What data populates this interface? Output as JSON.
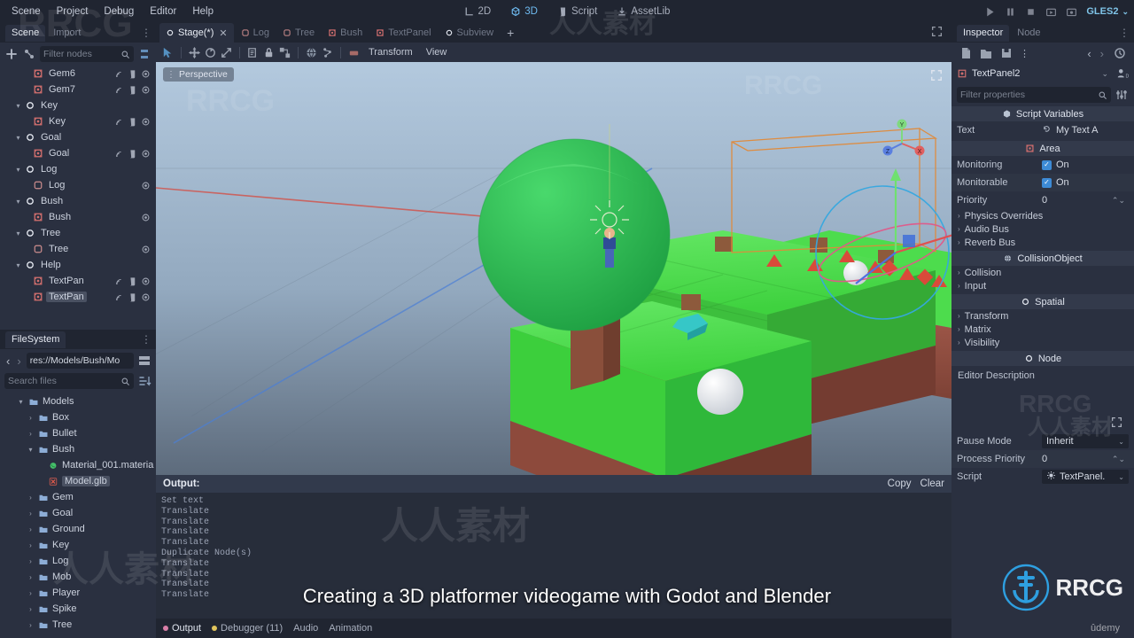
{
  "menubar": {
    "items": [
      "Scene",
      "Project",
      "Debug",
      "Editor",
      "Help"
    ]
  },
  "main_tabs": [
    {
      "label": "2D",
      "icon": "2d-icon",
      "active": false
    },
    {
      "label": "3D",
      "icon": "3d-icon",
      "active": true
    },
    {
      "label": "Script",
      "icon": "script-icon",
      "active": false
    },
    {
      "label": "AssetLib",
      "icon": "assetlib-icon",
      "active": false
    }
  ],
  "runbar": {
    "icons": [
      "play-icon",
      "pause-icon",
      "stop-icon",
      "play-scene-icon",
      "play-custom-scene-icon"
    ],
    "renderer": "GLES2"
  },
  "scene_panel": {
    "tabs": [
      {
        "label": "Scene",
        "active": true
      },
      {
        "label": "Import",
        "active": false
      }
    ],
    "toolbar_icons": [
      "add-node-icon",
      "instance-child-scene-icon"
    ],
    "filter_placeholder": "Filter nodes",
    "search_icon": "search-icon",
    "tree_options_icon": "tree-options-icon",
    "nodes": [
      {
        "label": "Gem6",
        "depth": 2,
        "icon": "area-icon",
        "caret": "",
        "actions": [
          "signal-icon",
          "script-icon",
          "visibility-icon"
        ],
        "selected": false
      },
      {
        "label": "Gem7",
        "depth": 2,
        "icon": "area-icon",
        "caret": "",
        "actions": [
          "signal-icon",
          "script-icon",
          "visibility-icon"
        ],
        "selected": false
      },
      {
        "label": "Key",
        "depth": 1,
        "icon": "spatial-icon",
        "caret": "▾",
        "actions": [],
        "selected": false
      },
      {
        "label": "Key",
        "depth": 2,
        "icon": "area-icon",
        "caret": "",
        "actions": [
          "signal-icon",
          "script-icon",
          "visibility-icon"
        ],
        "selected": false
      },
      {
        "label": "Goal",
        "depth": 1,
        "icon": "spatial-icon",
        "caret": "▾",
        "actions": [],
        "selected": false
      },
      {
        "label": "Goal",
        "depth": 2,
        "icon": "area-icon",
        "caret": "",
        "actions": [
          "signal-icon",
          "script-icon",
          "visibility-icon"
        ],
        "selected": false
      },
      {
        "label": "Log",
        "depth": 1,
        "icon": "spatial-icon",
        "caret": "▾",
        "actions": [],
        "selected": false
      },
      {
        "label": "Log",
        "depth": 2,
        "icon": "mesh-icon",
        "caret": "",
        "actions": [
          "visibility-icon"
        ],
        "selected": false
      },
      {
        "label": "Bush",
        "depth": 1,
        "icon": "spatial-icon",
        "caret": "▾",
        "actions": [],
        "selected": false
      },
      {
        "label": "Bush",
        "depth": 2,
        "icon": "area-icon",
        "caret": "",
        "actions": [
          "visibility-icon"
        ],
        "selected": false
      },
      {
        "label": "Tree",
        "depth": 1,
        "icon": "spatial-icon",
        "caret": "▾",
        "actions": [],
        "selected": false
      },
      {
        "label": "Tree",
        "depth": 2,
        "icon": "mesh-icon",
        "caret": "",
        "actions": [
          "visibility-icon"
        ],
        "selected": false
      },
      {
        "label": "Help",
        "depth": 1,
        "icon": "spatial-icon",
        "caret": "▾",
        "actions": [],
        "selected": false
      },
      {
        "label": "TextPan",
        "depth": 2,
        "icon": "area-icon",
        "caret": "",
        "actions": [
          "signal-icon",
          "script-icon",
          "visibility-icon"
        ],
        "selected": false
      },
      {
        "label": "TextPan",
        "depth": 2,
        "icon": "area-icon",
        "caret": "",
        "actions": [
          "signal-icon",
          "script-icon",
          "visibility-icon"
        ],
        "selected": true
      }
    ]
  },
  "filesystem_panel": {
    "title": "FileSystem",
    "path": "res://Models/Bush/Mo",
    "nav_back": "‹",
    "nav_forward": "›",
    "split_icon": "split-mode-icon",
    "search_placeholder": "Search files",
    "sort_icon": "sort-icon",
    "items": [
      {
        "label": "Models",
        "depth": 1,
        "caret": "▾",
        "type": "folder",
        "selected": false
      },
      {
        "label": "Box",
        "depth": 2,
        "caret": "›",
        "type": "folder",
        "selected": false
      },
      {
        "label": "Bullet",
        "depth": 2,
        "caret": "›",
        "type": "folder",
        "selected": false
      },
      {
        "label": "Bush",
        "depth": 2,
        "caret": "▾",
        "type": "folder",
        "selected": false
      },
      {
        "label": "Material_001.materia",
        "depth": 3,
        "caret": "",
        "type": "material",
        "selected": false
      },
      {
        "label": "Model.glb",
        "depth": 3,
        "caret": "",
        "type": "mesh-file",
        "selected": true
      },
      {
        "label": "Gem",
        "depth": 2,
        "caret": "›",
        "type": "folder",
        "selected": false
      },
      {
        "label": "Goal",
        "depth": 2,
        "caret": "›",
        "type": "folder",
        "selected": false
      },
      {
        "label": "Ground",
        "depth": 2,
        "caret": "›",
        "type": "folder",
        "selected": false
      },
      {
        "label": "Key",
        "depth": 2,
        "caret": "›",
        "type": "folder",
        "selected": false
      },
      {
        "label": "Log",
        "depth": 2,
        "caret": "›",
        "type": "folder",
        "selected": false
      },
      {
        "label": "Mob",
        "depth": 2,
        "caret": "›",
        "type": "folder",
        "selected": false
      },
      {
        "label": "Player",
        "depth": 2,
        "caret": "›",
        "type": "folder",
        "selected": false
      },
      {
        "label": "Spike",
        "depth": 2,
        "caret": "›",
        "type": "folder",
        "selected": false
      },
      {
        "label": "Tree",
        "depth": 2,
        "caret": "›",
        "type": "folder",
        "selected": false
      }
    ]
  },
  "scene_tabs": [
    {
      "label": "Stage(*)",
      "icon": "spatial-icon",
      "active": true,
      "close": "✕"
    },
    {
      "label": "Log",
      "icon": "mesh-icon",
      "active": false
    },
    {
      "label": "Tree",
      "icon": "mesh-icon",
      "active": false
    },
    {
      "label": "Bush",
      "icon": "area-icon",
      "active": false
    },
    {
      "label": "TextPanel",
      "icon": "area-icon",
      "active": false
    },
    {
      "label": "Subview",
      "icon": "spatial-icon",
      "active": false
    }
  ],
  "scene_tabs_add": "+",
  "viewport_toolbar": {
    "icons": [
      "select-mode-icon",
      "move-mode-icon",
      "rotate-mode-icon",
      "scale-mode-icon",
      "list-select-icon",
      "lock-icon",
      "group-icon",
      "environment-icon",
      "skeleton-icon",
      "ruler-icon"
    ],
    "menus": [
      "Transform",
      "View"
    ],
    "fullscreen_icon": "fullscreen-icon"
  },
  "viewport": {
    "label": "Perspective",
    "menu_icon": "viewport-menu-icon",
    "gizmo_axes": [
      "X",
      "Y",
      "Z"
    ]
  },
  "output_dock": {
    "title": "Output:",
    "copy_label": "Copy",
    "clear_label": "Clear",
    "lines": [
      "Set text",
      "Translate",
      "Translate",
      "Translate",
      "Translate",
      "Duplicate Node(s)",
      "Translate",
      "Translate",
      "Translate",
      "Translate"
    ]
  },
  "bottom_tabs": [
    {
      "label": "Output",
      "dot": "#d97fa8",
      "active": true
    },
    {
      "label": "Debugger (11)",
      "dot": "#e0c45c",
      "active": false
    },
    {
      "label": "Audio",
      "dot": "",
      "active": false
    },
    {
      "label": "Animation",
      "dot": "",
      "active": false
    }
  ],
  "inspector": {
    "tabs": [
      {
        "label": "Inspector",
        "active": true
      },
      {
        "label": "Node",
        "active": false
      }
    ],
    "toolbar_icons": [
      "new-resource-icon",
      "load-resource-icon",
      "save-resource-icon",
      "resource-menu-icon"
    ],
    "history_back": "‹",
    "history_forward": "›",
    "history_icon": "history-icon",
    "object_name": "TextPanel2",
    "object_icon": "area-icon",
    "object_dropdown": "⌄",
    "open_docs_icon": "open-docs-icon",
    "filter_placeholder": "Filter properties",
    "filter_search_icon": "search-icon",
    "filter_tools_icon": "property-tools-icon",
    "sections": [
      {
        "type": "header",
        "label": "Script Variables",
        "icon": "script-variables-icon"
      },
      {
        "type": "prop",
        "label": "Text",
        "value": "My Text A",
        "control": "revert-text"
      },
      {
        "type": "header",
        "label": "Area",
        "icon": "area-icon"
      },
      {
        "type": "prop",
        "label": "Monitoring",
        "value": "On",
        "control": "checkbox"
      },
      {
        "type": "prop",
        "label": "Monitorable",
        "value": "On",
        "control": "checkbox"
      },
      {
        "type": "prop",
        "label": "Priority",
        "value": "0",
        "control": "spinner"
      },
      {
        "type": "fold",
        "label": "Physics Overrides"
      },
      {
        "type": "fold",
        "label": "Audio Bus"
      },
      {
        "type": "fold",
        "label": "Reverb Bus"
      },
      {
        "type": "header",
        "label": "CollisionObject",
        "icon": "collision-object-icon"
      },
      {
        "type": "fold",
        "label": "Collision"
      },
      {
        "type": "fold",
        "label": "Input"
      },
      {
        "type": "header",
        "label": "Spatial",
        "icon": "spatial-icon"
      },
      {
        "type": "fold",
        "label": "Transform"
      },
      {
        "type": "fold",
        "label": "Matrix"
      },
      {
        "type": "fold",
        "label": "Visibility"
      },
      {
        "type": "header",
        "label": "Node",
        "icon": "node-icon"
      }
    ],
    "editor_description_label": "Editor Description",
    "bottom_props": [
      {
        "label": "Pause Mode",
        "value": "Inherit",
        "control": "select"
      },
      {
        "label": "Process Priority",
        "value": "0",
        "control": "spinner"
      },
      {
        "label": "Script",
        "value": "TextPanel.",
        "control": "script-select"
      }
    ]
  },
  "subtitle": "Creating a 3D platformer videogame with Godot and Blender",
  "watermarks": {
    "brand": "RRCG",
    "cn": "人人素材",
    "udemy": "ûdemy"
  },
  "colors": {
    "accent": "#6ebaf0",
    "panel": "#2a3040",
    "background": "#202531",
    "selection": "#4a5162",
    "checkbox": "#3d8bd6",
    "node_red": "#cd6d6d",
    "folder_blue": "#8dadd6"
  }
}
